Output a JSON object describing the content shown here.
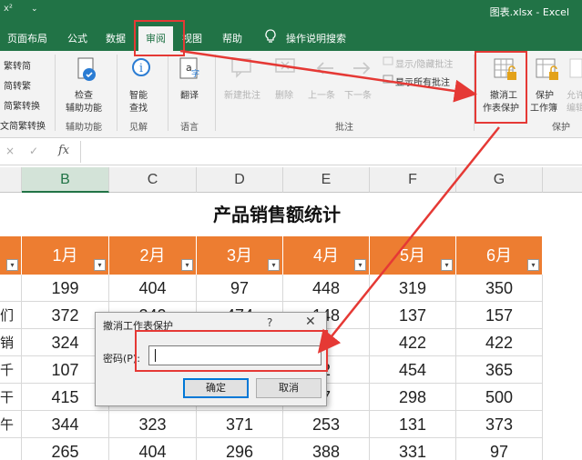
{
  "titlebar": {
    "quick_access": "x²",
    "dropdown": "⌄",
    "title": "图表.xlsx  -  Excel"
  },
  "menu": {
    "tabs": [
      {
        "label": "页面布局"
      },
      {
        "label": "公式"
      },
      {
        "label": "数据"
      },
      {
        "label": "审阅"
      },
      {
        "label": "视图"
      },
      {
        "label": "帮助"
      },
      {
        "label": "操作说明搜索"
      }
    ]
  },
  "ribbon": {
    "chinese_group": {
      "items": [
        "繁转简",
        "简转繁",
        "简繁转换",
        "文简繁转换"
      ]
    },
    "accessibility": {
      "line1": "检查",
      "line2": "辅助功能",
      "group": "辅助功能"
    },
    "insights": {
      "line1": "智能",
      "line2": "查找",
      "group": "见解"
    },
    "language": {
      "label": "翻译",
      "group": "语言"
    },
    "comments": {
      "new": "新建批注",
      "delete": "删除",
      "prev": "上一条",
      "next": "下一条",
      "show_hide": "显示/隐藏批注",
      "show_all": "显示所有批注",
      "group": "批注"
    },
    "protect": {
      "unprotect_line1": "撤消工",
      "unprotect_line2": "作表保护",
      "workbook_line1": "保护",
      "workbook_line2": "工作簿",
      "allow_line1": "允许",
      "allow_line2": "编辑",
      "group": "保护"
    }
  },
  "formula_bar": {
    "cancel": "×",
    "enter": "✓",
    "fx": "fx"
  },
  "columns": [
    "B",
    "C",
    "D",
    "E",
    "F",
    "G"
  ],
  "sheet": {
    "title": "产品销售额统计",
    "filter_glyph": "▾",
    "headers": [
      "1月",
      "2月",
      "3月",
      "4月",
      "5月",
      "6月"
    ],
    "left_fragments": [
      "",
      "们",
      "销",
      "千",
      "干",
      "午",
      ""
    ],
    "rows": [
      [
        "199",
        "404",
        "97",
        "448",
        "319",
        "350"
      ],
      [
        "372",
        "240",
        "474",
        "148",
        "137",
        "157"
      ],
      [
        "324",
        "",
        "",
        "",
        "422",
        "422"
      ],
      [
        "107",
        "",
        "",
        "2",
        "454",
        "365"
      ],
      [
        "415",
        "",
        "",
        "7",
        "298",
        "500"
      ],
      [
        "344",
        "323",
        "371",
        "253",
        "131",
        "373"
      ],
      [
        "265",
        "404",
        "296",
        "388",
        "331",
        "97"
      ]
    ]
  },
  "dialog": {
    "title": "撤消工作表保护",
    "help": "?",
    "close": "✕",
    "password_label": "密码(P):",
    "password_value": "",
    "ok": "确定",
    "cancel": "取消"
  },
  "colors": {
    "excel_green": "#217346",
    "header_orange": "#ed7d31",
    "annotation_red": "#e53935"
  }
}
